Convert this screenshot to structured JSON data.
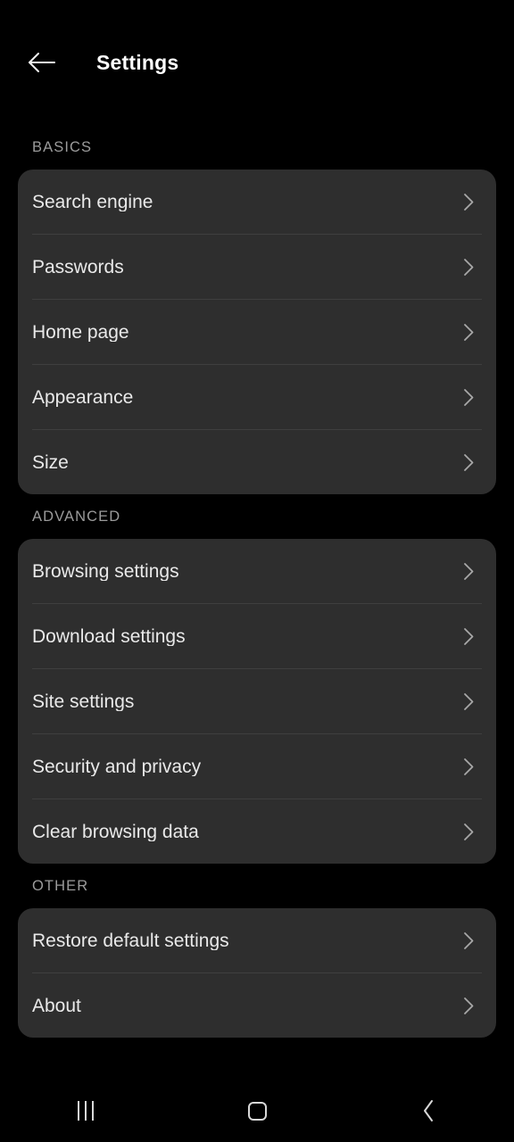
{
  "header": {
    "back_icon": "arrow-left-icon",
    "title": "Settings"
  },
  "sections": [
    {
      "label": "BASICS",
      "items": [
        {
          "label": "Search engine",
          "icon": "chevron-right-icon"
        },
        {
          "label": "Passwords",
          "icon": "chevron-right-icon"
        },
        {
          "label": "Home page",
          "icon": "chevron-right-icon"
        },
        {
          "label": "Appearance",
          "icon": "chevron-right-icon"
        },
        {
          "label": "Size",
          "icon": "chevron-right-icon"
        }
      ]
    },
    {
      "label": "ADVANCED",
      "items": [
        {
          "label": "Browsing settings",
          "icon": "chevron-right-icon"
        },
        {
          "label": "Download settings",
          "icon": "chevron-right-icon"
        },
        {
          "label": "Site settings",
          "icon": "chevron-right-icon"
        },
        {
          "label": "Security and privacy",
          "icon": "chevron-right-icon"
        },
        {
          "label": "Clear browsing data",
          "icon": "chevron-right-icon"
        }
      ]
    },
    {
      "label": "OTHER",
      "items": [
        {
          "label": "Restore default settings",
          "icon": "chevron-right-icon"
        },
        {
          "label": "About",
          "icon": "chevron-right-icon"
        }
      ]
    }
  ],
  "navbar": {
    "recents_label": "recents-icon",
    "home_label": "home-icon",
    "back_label": "back-icon"
  },
  "colors": {
    "background": "#000000",
    "card": "#2e2e2e",
    "primary_text": "#e9e9e9",
    "secondary_text": "#9b9b9b",
    "divider": "#3f3f3f"
  }
}
